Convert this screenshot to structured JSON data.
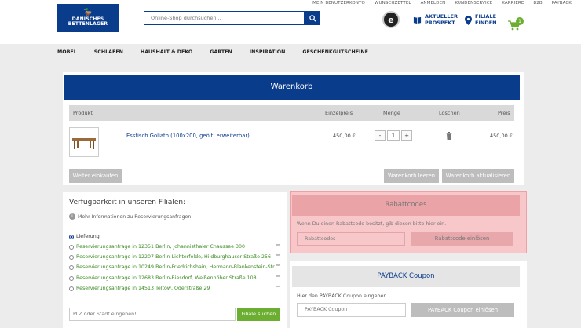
{
  "top_links": [
    "MEIN BENUTZERKONTO",
    "WUNSCHZETTEL",
    "ANMELDEN",
    "KUNDENSERVICE",
    "KARRIERE",
    "B2B",
    "PAYBACK"
  ],
  "logo": {
    "line1": "DÄNISCHES",
    "line2": "BETTENLAGER"
  },
  "search": {
    "placeholder": "Online-Shop durchsuchen..."
  },
  "trust_badge": "e",
  "header_links": {
    "prospekt_line1": "AKTUELLER",
    "prospekt_line2": "PROSPEKT",
    "filiale_line1": "FILIALE",
    "filiale_line2": "FINDEN"
  },
  "cart": {
    "count": "1"
  },
  "nav": [
    "MÖBEL",
    "SCHLAFEN",
    "HAUSHALT & DEKO",
    "GARTEN",
    "INSPIRATION",
    "GESCHENKGUTSCHEINE"
  ],
  "cart_panel": {
    "title": "Warenkorb",
    "columns": {
      "produkt": "Produkt",
      "einzelpreis": "Einzelpreis",
      "menge": "Menge",
      "loeschen": "Löschen",
      "preis": "Preis"
    },
    "item": {
      "name": "Esstisch Goliath (100x200, geölt, erweiterbar)",
      "unit_price": "450,00 €",
      "quantity": "1",
      "total": "450,00 €"
    },
    "qty_minus": "-",
    "qty_plus": "+",
    "continue_label": "Weiter einkaufen",
    "empty_label": "Warenkorb leeren",
    "update_label": "Warenkorb aktualisieren"
  },
  "availability": {
    "title": "Verfügbarkeit in unseren Filialen:",
    "info": "Mehr Informationen zu Reservierungsanfragen",
    "info_icon": "i",
    "options": [
      "Lieferung",
      "Reservierungsanfrage in 12351 Berlin, Johannisthaler Chaussee 300",
      "Reservierungsanfrage in 12207 Berlin-Lichterfelde, Hildburghauser Straße 256",
      "Reservierungsanfrage in 10249 Berlin-Friedrichshain, Hermann-Blankenstein-Str...",
      "Reservierungsanfrage in 12683 Berlin-Biesdorf, Weißenhöher Straße 108",
      "Reservierungsanfrage in 14513 Teltow, Oderstraße 29"
    ],
    "plz_placeholder": "PLZ oder Stadt eingeben!",
    "filiale_button": "Filiale suchen"
  },
  "rabatt": {
    "title": "Rabattcodes",
    "text": "Wenn Du einen Rabattcode besitzt, gib diesen bitte hier ein.",
    "placeholder": "Rabattcodes",
    "button": "Rabattcode einlösen"
  },
  "payback": {
    "title": "PAYBACK Coupon",
    "text": "Hier den PAYBACK Coupon eingeben.",
    "placeholder": "PAYBACK Coupon",
    "button": "PAYBACK Coupon einlösen"
  },
  "colors": {
    "brand_blue": "#0a3c8c",
    "green": "#6bae32",
    "highlight": "#f7c7c9"
  }
}
